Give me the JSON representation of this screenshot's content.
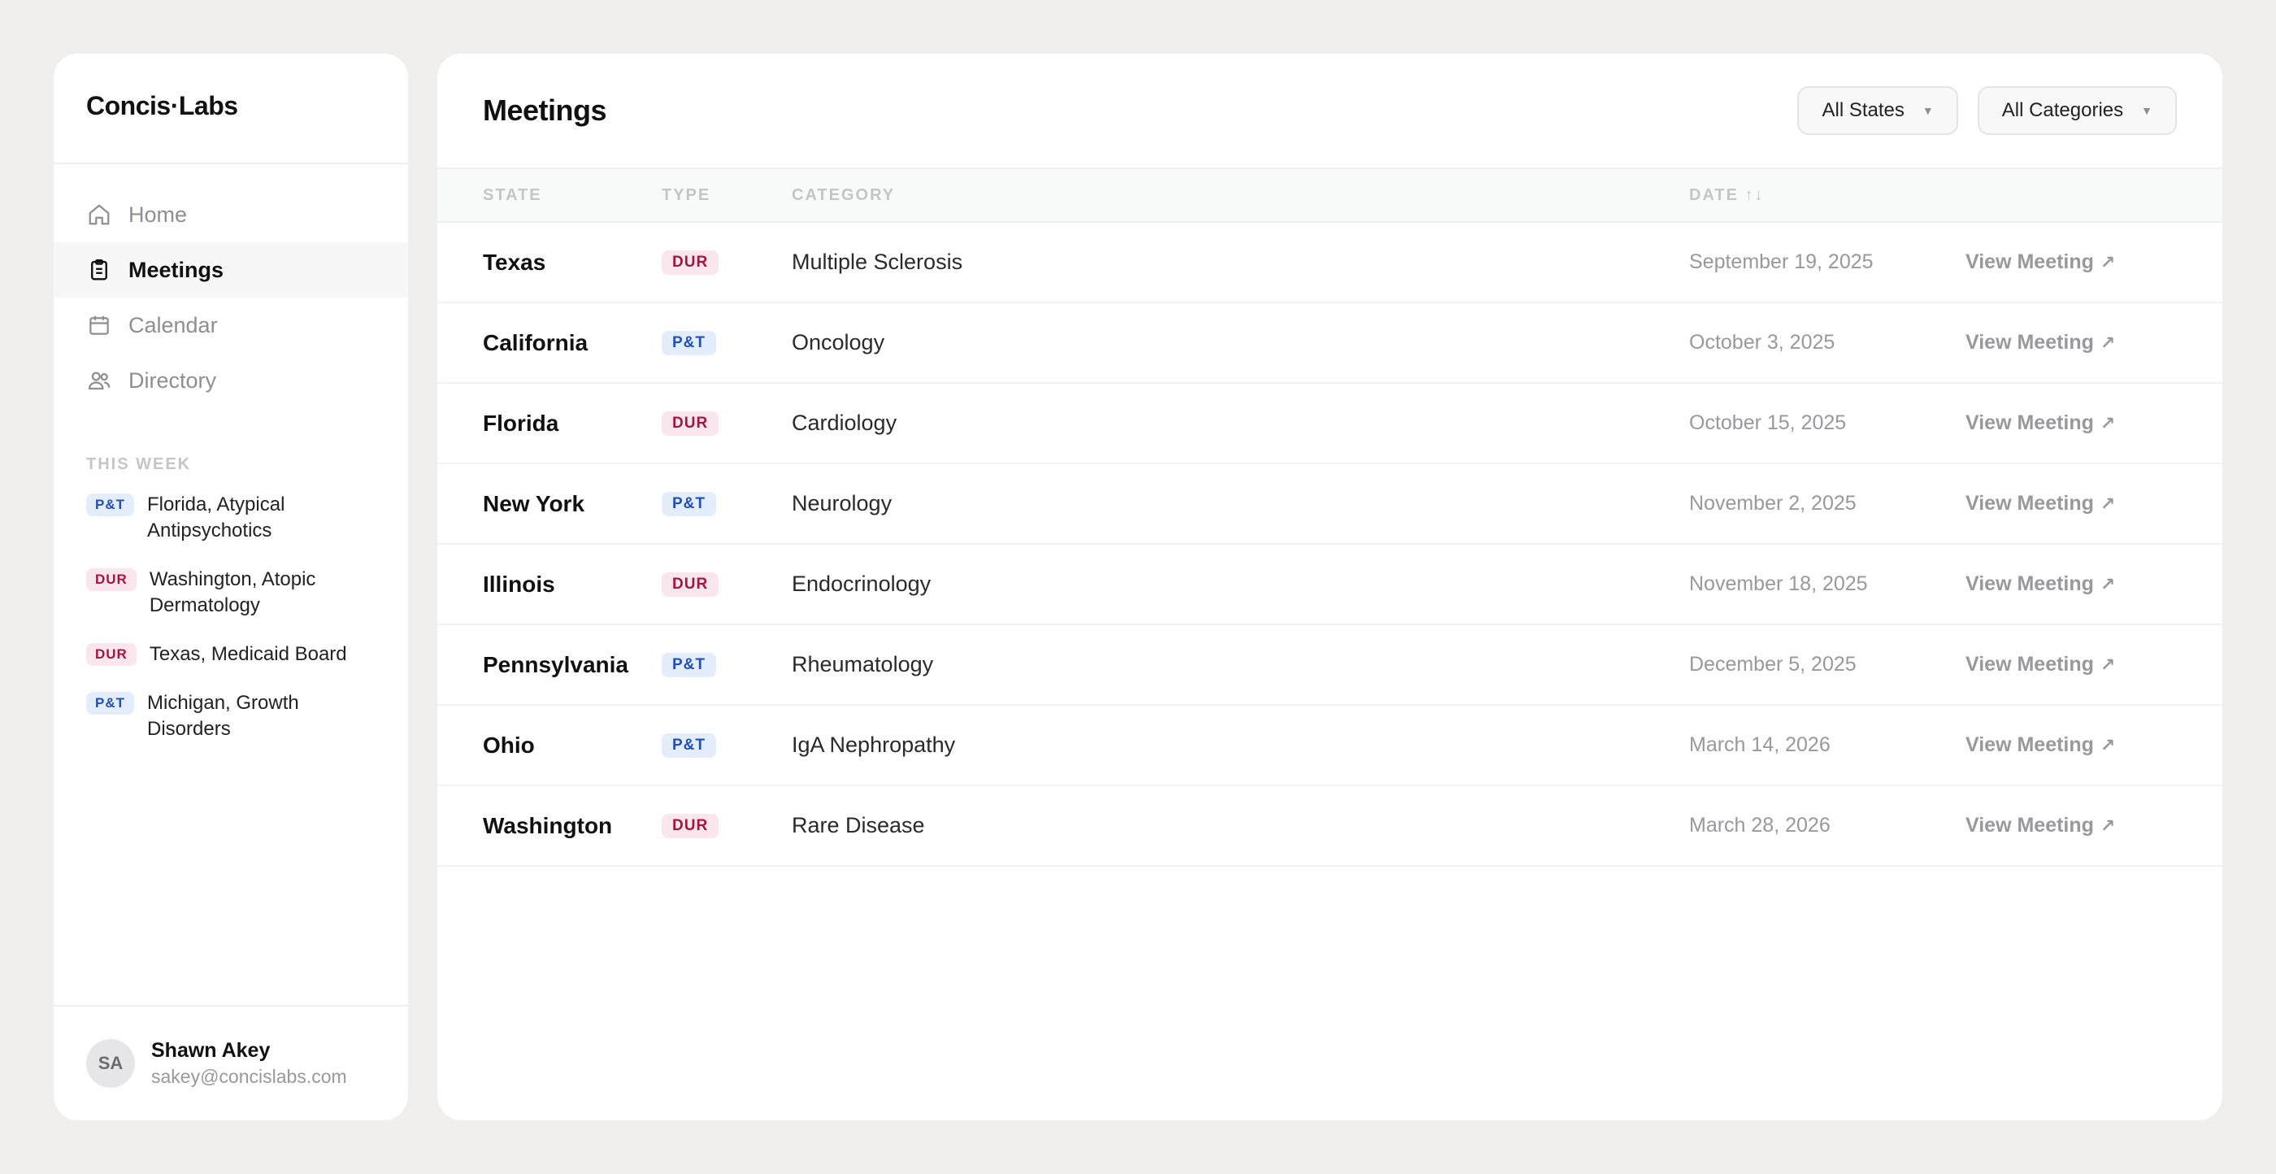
{
  "brand": "Concis·Labs",
  "nav": [
    {
      "label": "Home",
      "icon": "home-icon",
      "active": false
    },
    {
      "label": "Meetings",
      "icon": "clipboard-icon",
      "active": true
    },
    {
      "label": "Calendar",
      "icon": "calendar-icon",
      "active": false
    },
    {
      "label": "Directory",
      "icon": "users-icon",
      "active": false
    }
  ],
  "this_week": {
    "label": "THIS WEEK",
    "items": [
      {
        "badge": "P&T",
        "kind": "pt",
        "text": "Florida, Atypical Antipsychotics"
      },
      {
        "badge": "DUR",
        "kind": "dur",
        "text": "Washington, Atopic Dermatology"
      },
      {
        "badge": "DUR",
        "kind": "dur",
        "text": "Texas, Medicaid Board"
      },
      {
        "badge": "P&T",
        "kind": "pt",
        "text": "Michigan, Growth Disorders"
      }
    ]
  },
  "user": {
    "initials": "SA",
    "name": "Shawn Akey",
    "email": "sakey@concislabs.com"
  },
  "main": {
    "title": "Meetings",
    "filters": {
      "states": "All States",
      "categories": "All Categories"
    },
    "columns": {
      "state": "STATE",
      "type": "TYPE",
      "category": "CATEGORY",
      "date": "DATE ↑↓"
    },
    "action_label": "View Meeting",
    "rows": [
      {
        "state": "Texas",
        "type": "DUR",
        "kind": "dur",
        "category": "Multiple Sclerosis",
        "date": "September 19, 2025"
      },
      {
        "state": "California",
        "type": "P&T",
        "kind": "pt",
        "category": "Oncology",
        "date": "October 3, 2025"
      },
      {
        "state": "Florida",
        "type": "DUR",
        "kind": "dur",
        "category": "Cardiology",
        "date": "October 15, 2025"
      },
      {
        "state": "New York",
        "type": "P&T",
        "kind": "pt",
        "category": "Neurology",
        "date": "November 2, 2025"
      },
      {
        "state": "Illinois",
        "type": "DUR",
        "kind": "dur",
        "category": "Endocrinology",
        "date": "November 18, 2025"
      },
      {
        "state": "Pennsylvania",
        "type": "P&T",
        "kind": "pt",
        "category": "Rheumatology",
        "date": "December 5, 2025"
      },
      {
        "state": "Ohio",
        "type": "P&T",
        "kind": "pt",
        "category": "IgA Nephropathy",
        "date": "March 14, 2026"
      },
      {
        "state": "Washington",
        "type": "DUR",
        "kind": "dur",
        "category": "Rare Disease",
        "date": "March 28, 2026"
      }
    ]
  },
  "colors": {
    "pt_badge_bg": "#e3edfc",
    "pt_badge_text": "#2150b8",
    "dur_badge_bg": "#fbe6ee",
    "dur_badge_text": "#a5163f"
  }
}
